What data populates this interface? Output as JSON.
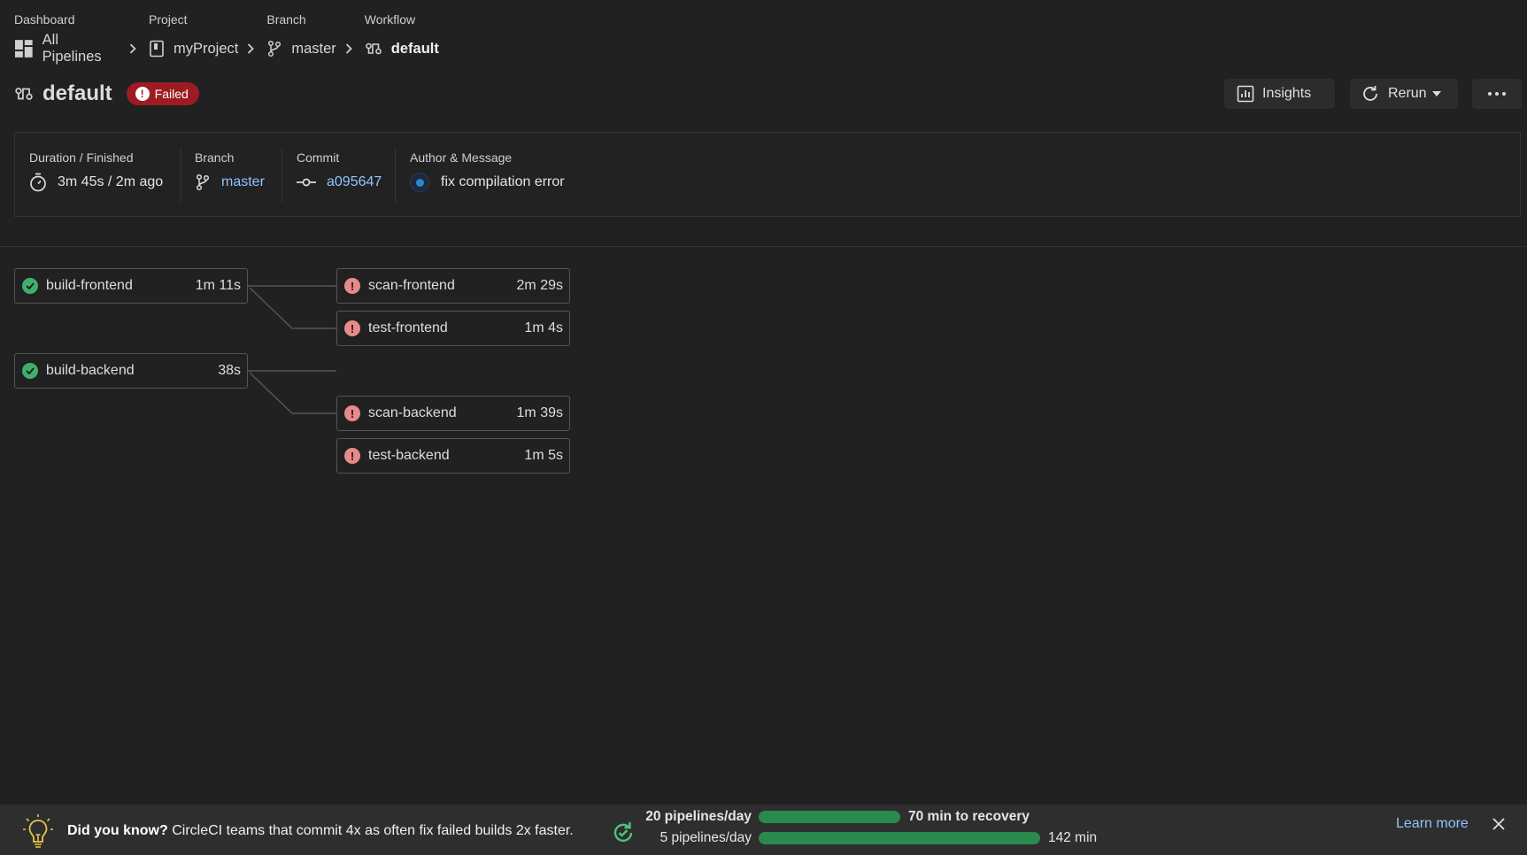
{
  "breadcrumbs": [
    {
      "label": "Dashboard",
      "value": "All Pipelines",
      "icon": "dashboard-icon"
    },
    {
      "label": "Project",
      "value": "myProject",
      "icon": "project-icon"
    },
    {
      "label": "Branch",
      "value": "master",
      "icon": "branch-icon"
    },
    {
      "label": "Workflow",
      "value": "default",
      "icon": "workflow-icon"
    }
  ],
  "header": {
    "title": "default",
    "status": "Failed",
    "insights_label": "Insights",
    "rerun_label": "Rerun"
  },
  "summary": {
    "duration_label": "Duration / Finished",
    "duration_value": "3m 45s / 2m ago",
    "branch_label": "Branch",
    "branch_value": "master",
    "commit_label": "Commit",
    "commit_value": "a095647",
    "author_label": "Author & Message",
    "message": "fix compilation error"
  },
  "jobs": [
    {
      "name": "build-frontend",
      "duration": "1m 11s",
      "status": "success"
    },
    {
      "name": "scan-frontend",
      "duration": "2m 29s",
      "status": "failed"
    },
    {
      "name": "test-frontend",
      "duration": "1m 4s",
      "status": "failed"
    },
    {
      "name": "build-backend",
      "duration": "38s",
      "status": "success"
    },
    {
      "name": "scan-backend",
      "duration": "1m 39s",
      "status": "failed"
    },
    {
      "name": "test-backend",
      "duration": "1m 5s",
      "status": "failed"
    }
  ],
  "footer": {
    "tip_bold": "Did you know?",
    "tip_text": "CircleCI teams that commit 4x as often fix failed builds 2x faster.",
    "row1_left": "20 pipelines/day",
    "row1_right": "70 min to recovery",
    "row2_left": "5 pipelines/day",
    "row2_right": "142 min",
    "learn_more": "Learn more"
  },
  "colors": {
    "background": "#212121",
    "failed_badge": "#9d1c23",
    "success": "#3fb06b",
    "failed_job": "#e88a8a",
    "link": "#8ec5ff",
    "bar": "#2a8a4e"
  }
}
